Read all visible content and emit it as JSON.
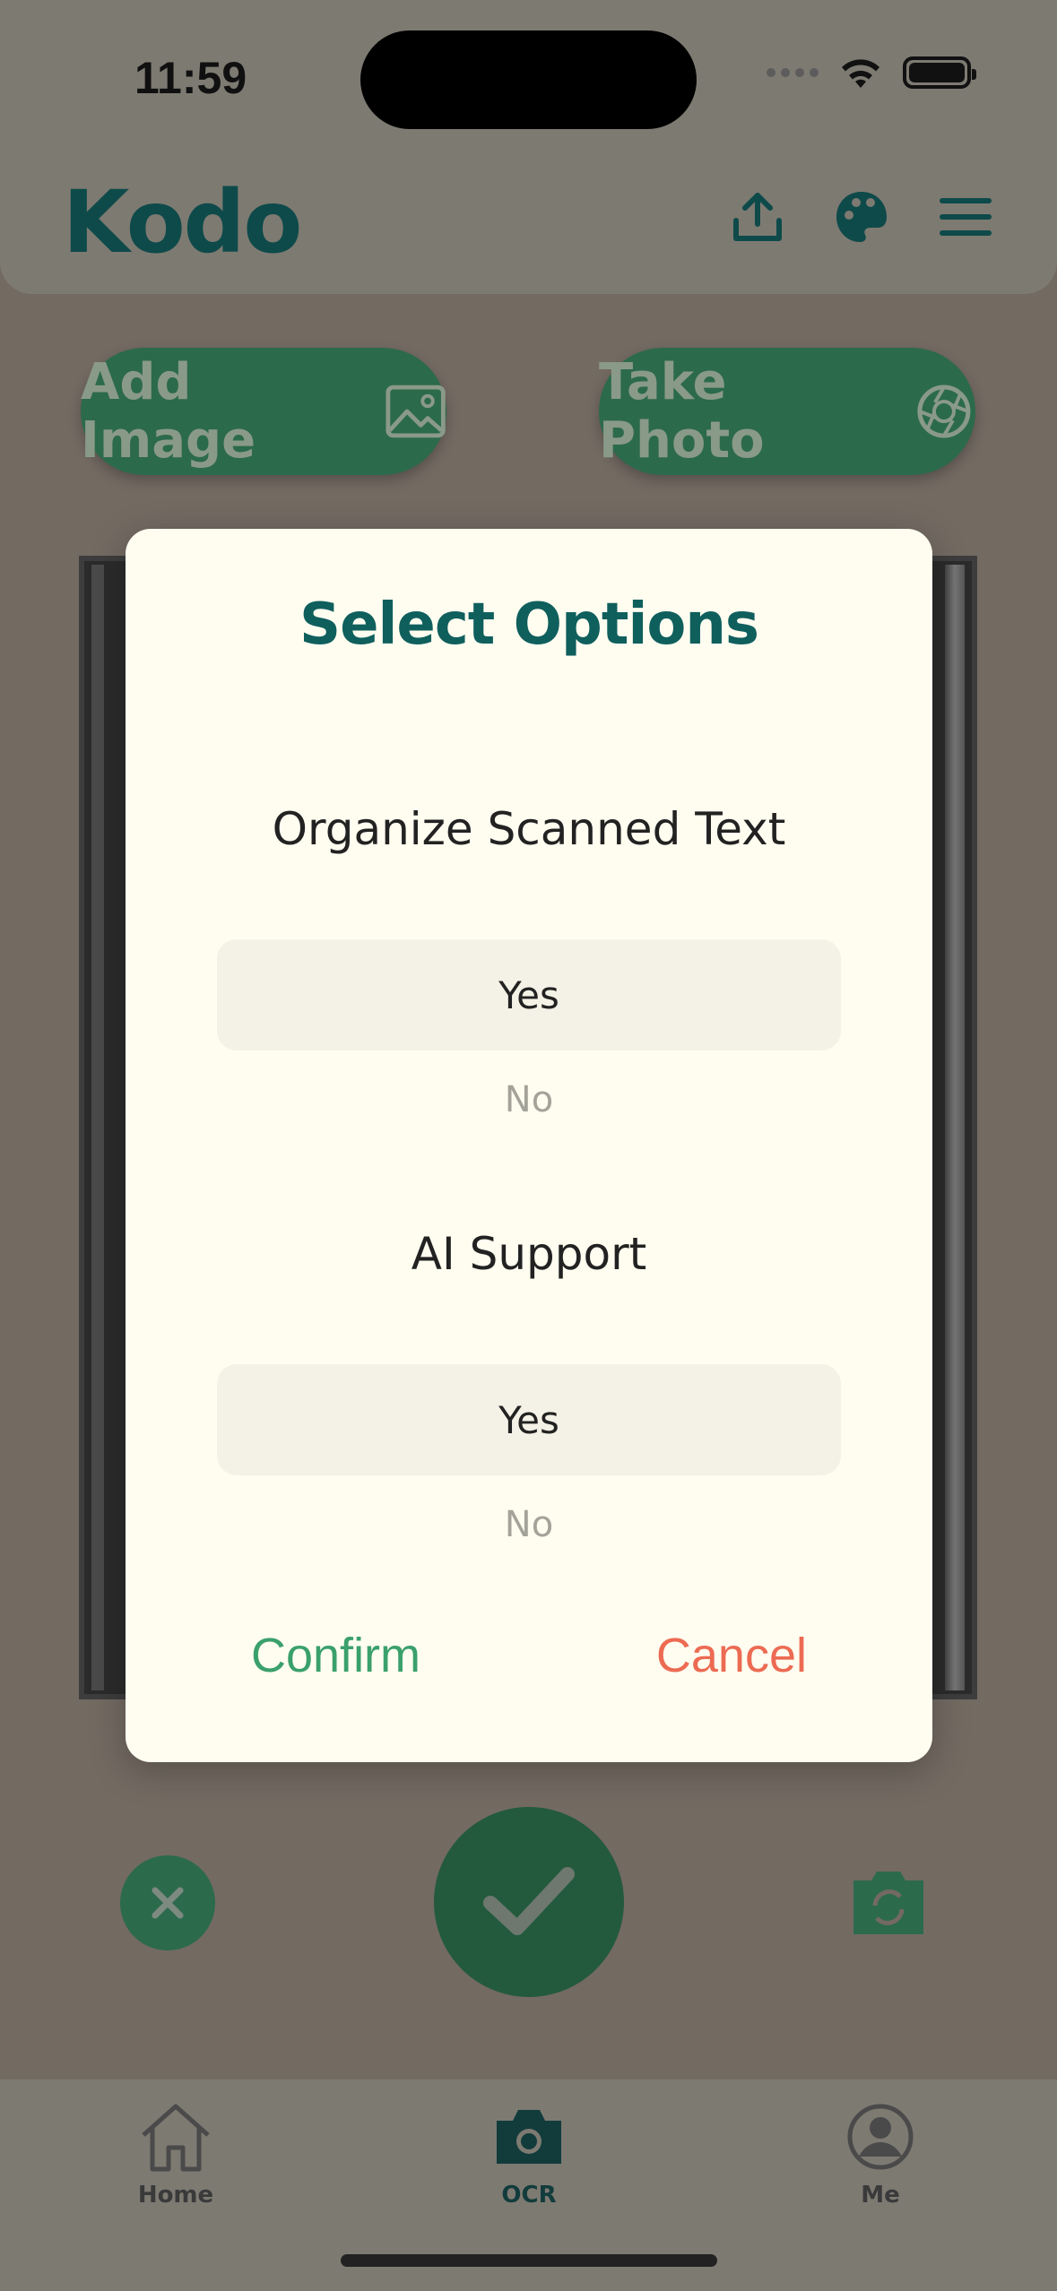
{
  "status": {
    "time": "11:59"
  },
  "header": {
    "logo": "Kodo",
    "icons": [
      "upload-icon",
      "palette-icon",
      "menu-icon"
    ]
  },
  "actions": {
    "add_image": "Add Image",
    "take_photo": "Take Photo"
  },
  "modal": {
    "title": "Select Options",
    "sections": [
      {
        "label": "Organize Scanned Text",
        "selected": "Yes",
        "other": "No"
      },
      {
        "label": "AI Support",
        "selected": "Yes",
        "other": "No"
      }
    ],
    "confirm": "Confirm",
    "cancel": "Cancel"
  },
  "tabs": [
    {
      "label": "Home",
      "icon": "home-icon"
    },
    {
      "label": "OCR",
      "icon": "camera-icon",
      "active": true
    },
    {
      "label": "Me",
      "icon": "profile-icon"
    }
  ],
  "colors": {
    "brand_green": "#2c6a4c",
    "title_teal": "#0f5f5d",
    "confirm_green": "#3aa06c",
    "cancel_red": "#ec6b52",
    "modal_bg": "#fffdf0"
  }
}
